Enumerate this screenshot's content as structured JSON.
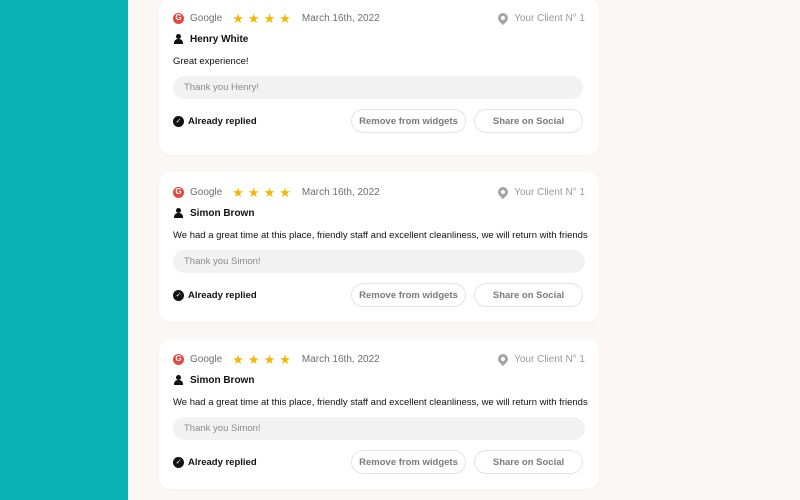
{
  "reviews": [
    {
      "source": "Google",
      "source_icon": "G",
      "stars": 4,
      "date": "March 16th, 2022",
      "client": "Your Client N° 1",
      "author": "Henry White",
      "text": "Great experience!",
      "reply_placeholder": "Thank you Henry!",
      "status": "Already replied",
      "remove_label": "Remove from widgets",
      "share_label": "Share on Social"
    },
    {
      "source": "Google",
      "source_icon": "G",
      "stars": 4,
      "date": "March 16th, 2022",
      "client": "Your Client N° 1",
      "author": "Simon Brown",
      "text": "We had a great time at this place, friendly staff and excellent cleanliness, we will return with friends",
      "reply_placeholder": "Thank you Simon!",
      "status": "Already replied",
      "remove_label": "Remove from widgets",
      "share_label": "Share on Social"
    },
    {
      "source": "Google",
      "source_icon": "G",
      "stars": 4,
      "date": "March 16th, 2022",
      "client": "Your Client N° 1",
      "author": "Simon Brown",
      "text": "We had a great time at this place, friendly staff and excellent cleanliness, we will return with friends",
      "reply_placeholder": "Thank you Simon!",
      "status": "Already replied",
      "remove_label": "Remove from widgets",
      "share_label": "Share on Social"
    }
  ],
  "colors": {
    "sidebar": "#0cb1b5",
    "background": "#fbf7f5",
    "star": "#f6b500",
    "google": "#e8453c"
  },
  "icons": {
    "source": "google-icon",
    "star": "star-icon",
    "client": "location-pin-icon",
    "author": "user-icon",
    "status": "check-circle-icon"
  }
}
